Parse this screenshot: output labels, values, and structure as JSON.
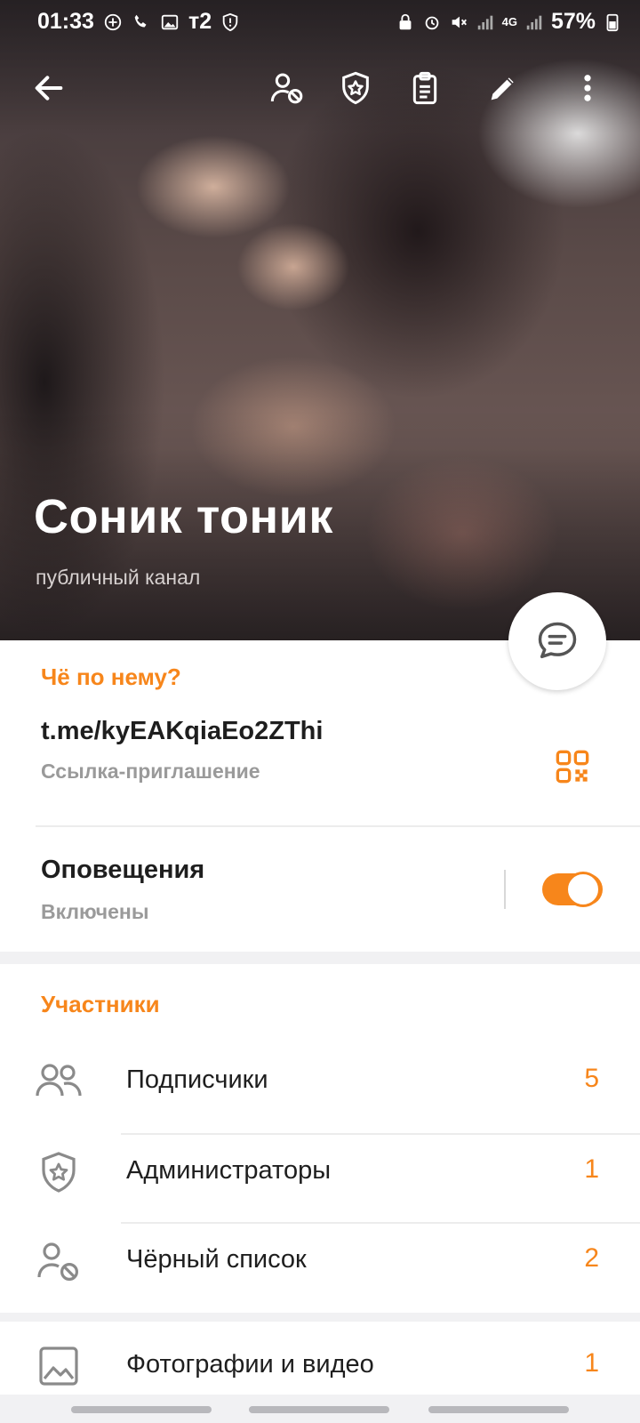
{
  "status_bar": {
    "time": "01:33",
    "carrier": "т2",
    "network": "4G",
    "battery": "57%"
  },
  "toolbar": {
    "icons": [
      "back-arrow-icon",
      "user-blocked-icon",
      "shield-star-icon",
      "clipboard-icon",
      "pencil-icon",
      "more-vertical-icon"
    ]
  },
  "channel": {
    "title": "Соник тоник",
    "subtitle": "публичный канал"
  },
  "info": {
    "section_title": "Чё по нему?",
    "link": "t.me/kyEAKqiaEo2ZThi",
    "link_caption": "Ссылка-приглашение",
    "notifications_title": "Оповещения",
    "notifications_status": "Включены",
    "notifications_on": true
  },
  "members": {
    "section_title": "Участники",
    "items": [
      {
        "label": "Подписчики",
        "count": "5",
        "icon": "users-icon"
      },
      {
        "label": "Администраторы",
        "count": "1",
        "icon": "shield-star-icon"
      },
      {
        "label": "Чёрный список",
        "count": "2",
        "icon": "user-blocked-icon"
      }
    ]
  },
  "media": {
    "label": "Фотографии и видео",
    "count": "1",
    "icon": "image-icon"
  },
  "colors": {
    "accent": "#f7861b",
    "text": "#1e1e1e",
    "muted": "#9a9a9a"
  }
}
